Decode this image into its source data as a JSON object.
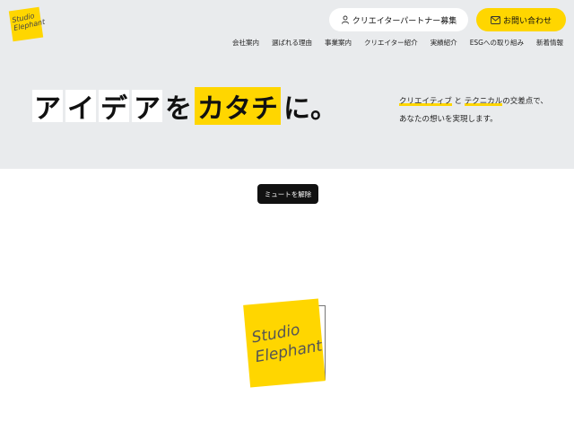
{
  "brand": {
    "logo_text_line1": "Studio",
    "logo_text_line2": "Elephant",
    "accent_color": "#ffd600"
  },
  "header": {
    "partner_button": "クリエイターパートナー募集",
    "partner_icon": "user-icon",
    "contact_button": "お問い合わせ",
    "contact_icon": "mail-icon"
  },
  "nav": {
    "items": [
      "会社案内",
      "選ばれる理由",
      "事業案内",
      "クリエイター紹介",
      "実績紹介",
      "ESGへの取り組み",
      "新着情報"
    ]
  },
  "hero": {
    "headline_chars": [
      "ア",
      "イ",
      "デ",
      "ア",
      "を",
      "カタチ",
      "に。"
    ],
    "subtext_line1_a": "クリエイティブ",
    "subtext_line1_b": "と",
    "subtext_line1_c": "テクニカル",
    "subtext_line1_d": "の交差点で、",
    "subtext_line2": "あなたの想いを実現します。"
  },
  "video": {
    "mute_button": "ミュートを解除"
  }
}
